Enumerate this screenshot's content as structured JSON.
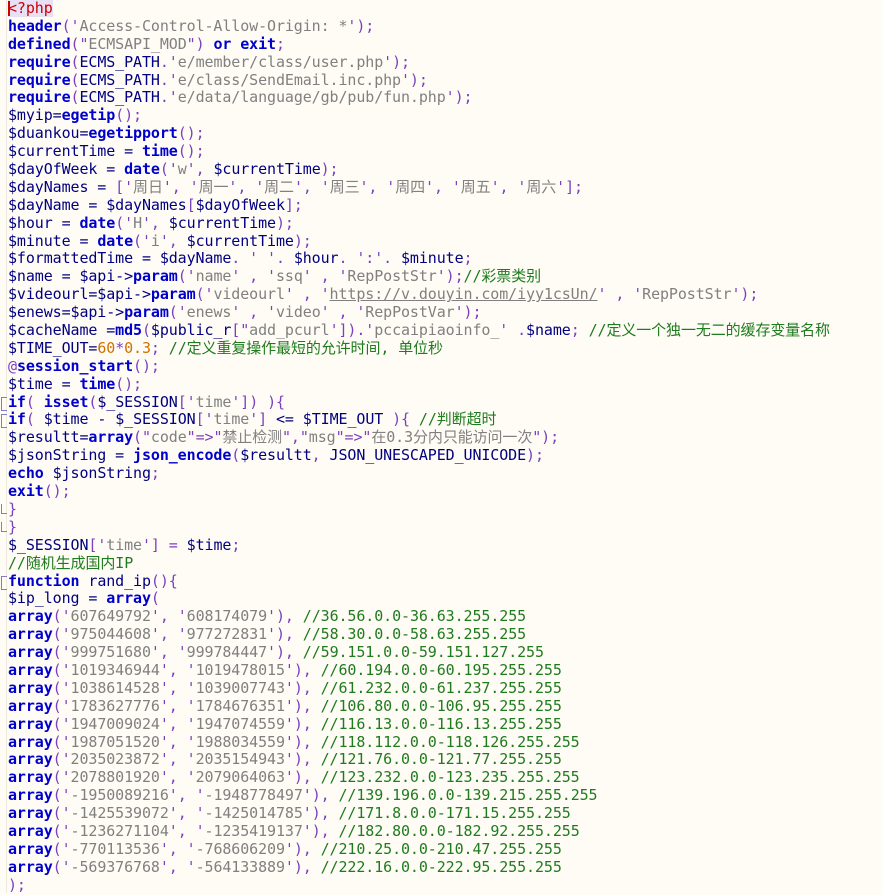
{
  "editor": {
    "language": "php",
    "background_color": "#FFFCF5",
    "font_size_px": 15,
    "colors": {
      "keyword": "#0000CC",
      "variable": "#000080",
      "punctuation": "#7B3FBF",
      "string": "#808080",
      "number": "#D07000",
      "comment": "#1E7B1E",
      "php_tag": "#CC0000",
      "php_tag_background": "#E8E0F5",
      "url_link": "#808080"
    }
  },
  "code": {
    "lines": [
      "<?php",
      "header('Access-Control-Allow-Origin: *');",
      "defined(\"ECMSAPI_MOD\") or exit;",
      "require(ECMS_PATH.'e/member/class/user.php');",
      "require(ECMS_PATH.'e/class/SendEmail.inc.php');",
      "require(ECMS_PATH.'e/data/language/gb/pub/fun.php');",
      "$myip=egetip();",
      "$duankou=egetipport();",
      "$currentTime = time();",
      "$dayOfWeek = date('w', $currentTime);",
      "$dayNames = ['周日', '周一', '周二', '周三', '周四', '周五', '周六'];",
      "$dayName = $dayNames[$dayOfWeek];",
      "$hour = date('H', $currentTime);",
      "$minute = date('i', $currentTime);",
      "$formattedTime = $dayName. ' '. $hour. ':'. $minute;",
      "$name = $api->param('name' , 'ssq' , 'RepPostStr');//彩票类别",
      "$videourl=$api->param('videourl' , 'https://v.douyin.com/iyy1csUn/' , 'RepPostStr');",
      "$enews=$api->param('enews' , 'video' , 'RepPostVar');",
      "$cacheName =md5($public_r['add_pcurl']).'pccaipiaoinfo_' .$name; //定义一个独一无二的缓存变量名称",
      "$TIME_OUT=60*0.3; //定义重复操作最短的允许时间, 单位秒",
      "@session_start();",
      "$time = time();",
      "if( isset($_SESSION['time']) ){",
      "if( $time - $_SESSION['time'] <= $TIME_OUT ){ //判断超时",
      "$resultt=array(\"code\"=>\"禁止检测\",\"msg\"=>\"在0.3分内只能访问一次\");",
      "$jsonString = json_encode($resultt, JSON_UNESCAPED_UNICODE);",
      "echo $jsonString;",
      "exit();",
      "}",
      "}",
      "$_SESSION['time'] = $time;",
      "//随机生成国内IP",
      "function rand_ip(){",
      "$ip_long = array(",
      "array('607649792', '608174079'), //36.56.0.0-36.63.255.255",
      "array('975044608', '977272831'), //58.30.0.0-58.63.255.255",
      "array('999751680', '999784447'), //59.151.0.0-59.151.127.255",
      "array('1019346944', '1019478015'), //60.194.0.0-60.195.255.255",
      "array('1038614528', '1039007743'), //61.232.0.0-61.237.255.255",
      "array('1783627776', '1784676351'), //106.80.0.0-106.95.255.255",
      "array('1947009024', '1947074559'), //116.13.0.0-116.13.255.255",
      "array('1987051520', '1988034559'), //118.112.0.0-118.126.255.255",
      "array('2035023872', '2035154943'), //121.76.0.0-121.77.255.255",
      "array('2078801920', '2079064063'), //123.232.0.0-123.235.255.255",
      "array('-1950089216', '-1948778497'), //139.196.0.0-139.215.255.255",
      "array('-1425539072', '-1425014785'), //171.8.0.0-171.15.255.255",
      "array('-1236271104', '-1235419137'), //182.80.0.0-182.92.255.255",
      "array('-770113536', '-768606209'), //210.25.0.0-210.47.255.255",
      "array('-569376768', '-564133889'), //222.16.0.0-222.95.255.255",
      ");"
    ],
    "day_names": [
      "周日",
      "周一",
      "周二",
      "周三",
      "周四",
      "周五",
      "周六"
    ],
    "comments": {
      "lottery_category": "//彩票类别",
      "cache_var_name": "//定义一个独一无二的缓存变量名称",
      "timeout_define": "//定义重复操作最短的允许时间, 单位秒",
      "judge_timeout": "//判断超时",
      "random_domestic_ip": "//随机生成国内IP"
    },
    "strings": {
      "forbid_detect": "禁止检测",
      "rate_limit_msg": "在0.3分内只能访问一次",
      "video_url": "https://v.douyin.com/iyy1csUn/"
    },
    "ip_ranges": [
      {
        "start": "607649792",
        "end": "608174079",
        "comment": "//36.56.0.0-36.63.255.255"
      },
      {
        "start": "975044608",
        "end": "977272831",
        "comment": "//58.30.0.0-58.63.255.255"
      },
      {
        "start": "999751680",
        "end": "999784447",
        "comment": "//59.151.0.0-59.151.127.255"
      },
      {
        "start": "1019346944",
        "end": "1019478015",
        "comment": "//60.194.0.0-60.195.255.255"
      },
      {
        "start": "1038614528",
        "end": "1039007743",
        "comment": "//61.232.0.0-61.237.255.255"
      },
      {
        "start": "1783627776",
        "end": "1784676351",
        "comment": "//106.80.0.0-106.95.255.255"
      },
      {
        "start": "1947009024",
        "end": "1947074559",
        "comment": "//116.13.0.0-116.13.255.255"
      },
      {
        "start": "1987051520",
        "end": "1988034559",
        "comment": "//118.112.0.0-118.126.255.255"
      },
      {
        "start": "2035023872",
        "end": "2035154943",
        "comment": "//121.76.0.0-121.77.255.255"
      },
      {
        "start": "2078801920",
        "end": "2079064063",
        "comment": "//123.232.0.0-123.235.255.255"
      },
      {
        "start": "-1950089216",
        "end": "-1948778497",
        "comment": "//139.196.0.0-139.215.255.255"
      },
      {
        "start": "-1425539072",
        "end": "-1425014785",
        "comment": "//171.8.0.0-171.15.255.255"
      },
      {
        "start": "-1236271104",
        "end": "-1235419137",
        "comment": "//182.80.0.0-182.92.255.255"
      },
      {
        "start": "-770113536",
        "end": "-768606209",
        "comment": "//210.25.0.0-210.47.255.255"
      },
      {
        "start": "-569376768",
        "end": "-564133889",
        "comment": "//222.16.0.0-222.95.255.255"
      }
    ]
  }
}
